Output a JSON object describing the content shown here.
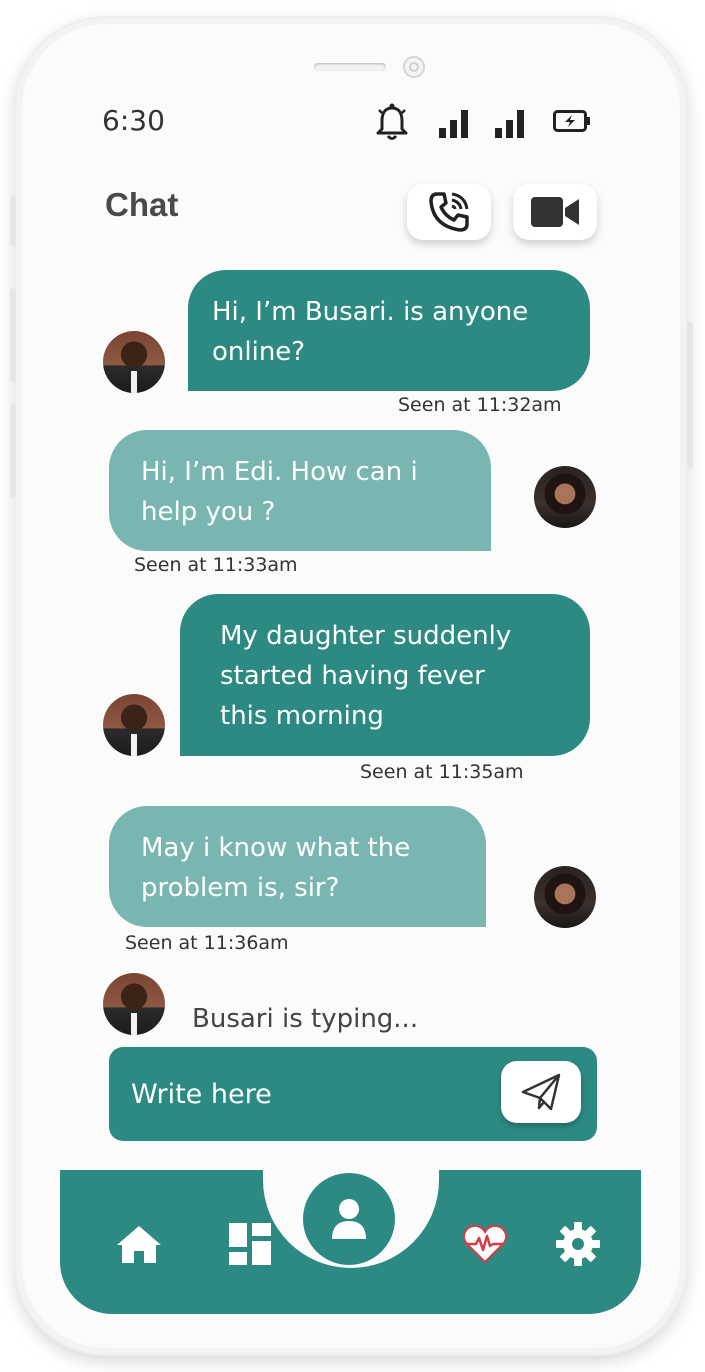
{
  "status_bar": {
    "time": "6:30",
    "icons": [
      "bell-icon",
      "signal-icon",
      "signal-icon",
      "battery-icon"
    ]
  },
  "header": {
    "title": "Chat",
    "voice_call_icon": "phone-call-icon",
    "video_call_icon": "video-camera-icon"
  },
  "messages": [
    {
      "direction": "outgoing",
      "sender": "Busari",
      "lines": [
        "Hi, I’m Busari. is anyone",
        "online?"
      ],
      "seen": "Seen at 11:32am"
    },
    {
      "direction": "incoming",
      "sender": "Edi",
      "lines": [
        "Hi, I’m Edi. How can i",
        "help you ?"
      ],
      "seen": "Seen at 11:33am"
    },
    {
      "direction": "outgoing",
      "sender": "Busari",
      "lines": [
        "My daughter suddenly",
        "started having fever",
        "this morning"
      ],
      "seen": "Seen at 11:35am"
    },
    {
      "direction": "incoming",
      "sender": "Edi",
      "lines": [
        "May i know what the",
        "problem is, sir?"
      ],
      "seen": "Seen at 11:36am"
    }
  ],
  "typing_indicator": "Busari is typing...",
  "composer": {
    "placeholder": "Write here",
    "send_icon": "paper-plane-icon"
  },
  "bottom_nav": {
    "items": [
      "home-icon",
      "dashboard-icon",
      "profile-icon",
      "heart-pulse-icon",
      "settings-icon"
    ]
  },
  "colors": {
    "primary": "#2d8a83",
    "incoming_bubble": "#79b6b2",
    "background": "#fbfbfb",
    "heart": "#d93a45"
  }
}
